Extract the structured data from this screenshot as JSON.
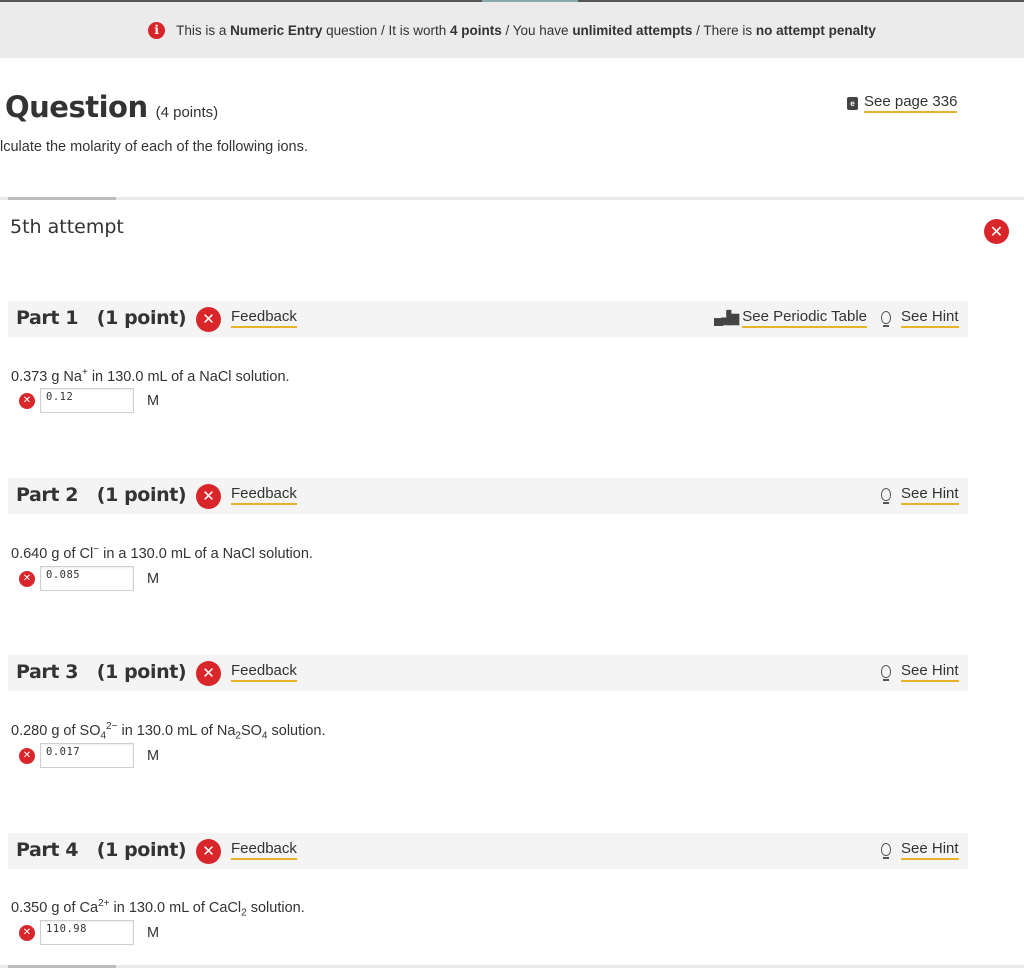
{
  "banner": {
    "prefix": "This is a ",
    "type": "Numeric Entry",
    "mid1": " question / It is worth ",
    "points": "4 points",
    "mid2": " / You have ",
    "attempts": "unlimited attempts",
    "mid3": " / There is ",
    "penalty": "no attempt penalty"
  },
  "question": {
    "title": "Question",
    "points": "(4 points)",
    "see_page": "See page 336",
    "text": "lculate the molarity of each of the following ions."
  },
  "attempt": {
    "label": "5th attempt"
  },
  "labels": {
    "feedback": "Feedback",
    "see_periodic_table": "See Periodic Table",
    "see_hint": "See Hint",
    "unit": "M"
  },
  "parts": [
    {
      "title": "Part 1",
      "points": "(1 point)",
      "answer": "0.12",
      "prompt": {
        "a": "0.373 g Na",
        "b": "+",
        "c": " in 130.0 mL of a NaCl solution."
      }
    },
    {
      "title": "Part 2",
      "points": "(1 point)",
      "answer": "0.085",
      "prompt": {
        "a": "0.640 g of Cl",
        "b": "−",
        "c": " in a 130.0 mL of a NaCl solution."
      }
    },
    {
      "title": "Part 3",
      "points": "(1 point)",
      "answer": "0.017",
      "prompt": {
        "a": "0.280 g of SO",
        "b": "4",
        "c": "2−",
        "d": " in 130.0 mL of Na",
        "e": "2",
        "f": "SO",
        "g": "4",
        "h": " solution."
      }
    },
    {
      "title": "Part 4",
      "points": "(1 point)",
      "answer": "110.98",
      "prompt": {
        "a": "0.350 g of Ca",
        "b": "2+",
        "c": " in 130.0 mL of CaCl",
        "d": "2",
        "e": " solution."
      }
    }
  ]
}
